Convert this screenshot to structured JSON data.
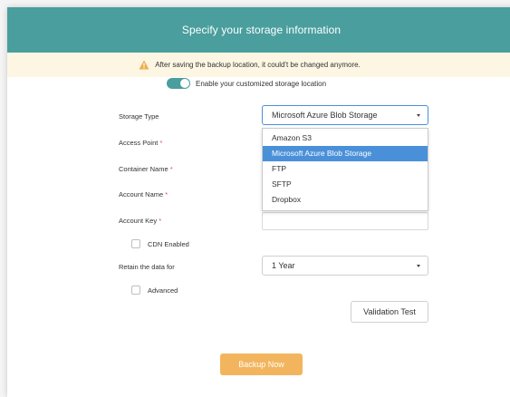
{
  "header": {
    "title": "Specify your storage information"
  },
  "warning": {
    "text": "After saving the backup location, it could't be changed anymore."
  },
  "toggle": {
    "label": "Enable your customized storage location",
    "on": true
  },
  "form": {
    "storage_type_label": "Storage Type",
    "storage_type_value": "Microsoft Azure Blob Storage",
    "storage_type_options": [
      "Amazon S3",
      "Microsoft Azure Blob Storage",
      "FTP",
      "SFTP",
      "Dropbox"
    ],
    "access_point_label": "Access Point",
    "container_name_label": "Container Name",
    "account_name_label": "Account Name",
    "account_key_label": "Account Key",
    "required_mark": "*",
    "cdn_enabled_label": "CDN Enabled",
    "retain_label": "Retain the data for",
    "retain_value": "1 Year",
    "advanced_label": "Advanced"
  },
  "buttons": {
    "validation_test": "Validation Test",
    "backup_now": "Backup Now"
  },
  "colors": {
    "accent": "#4a9e9e",
    "selected_option": "#4a90d9",
    "backup_button": "#f2b55e",
    "warning_bg": "#fcf6e3",
    "required": "#d9534f"
  },
  "icons": {
    "warning": "warning-triangle-icon",
    "dropdown": "chevron-down-icon"
  }
}
